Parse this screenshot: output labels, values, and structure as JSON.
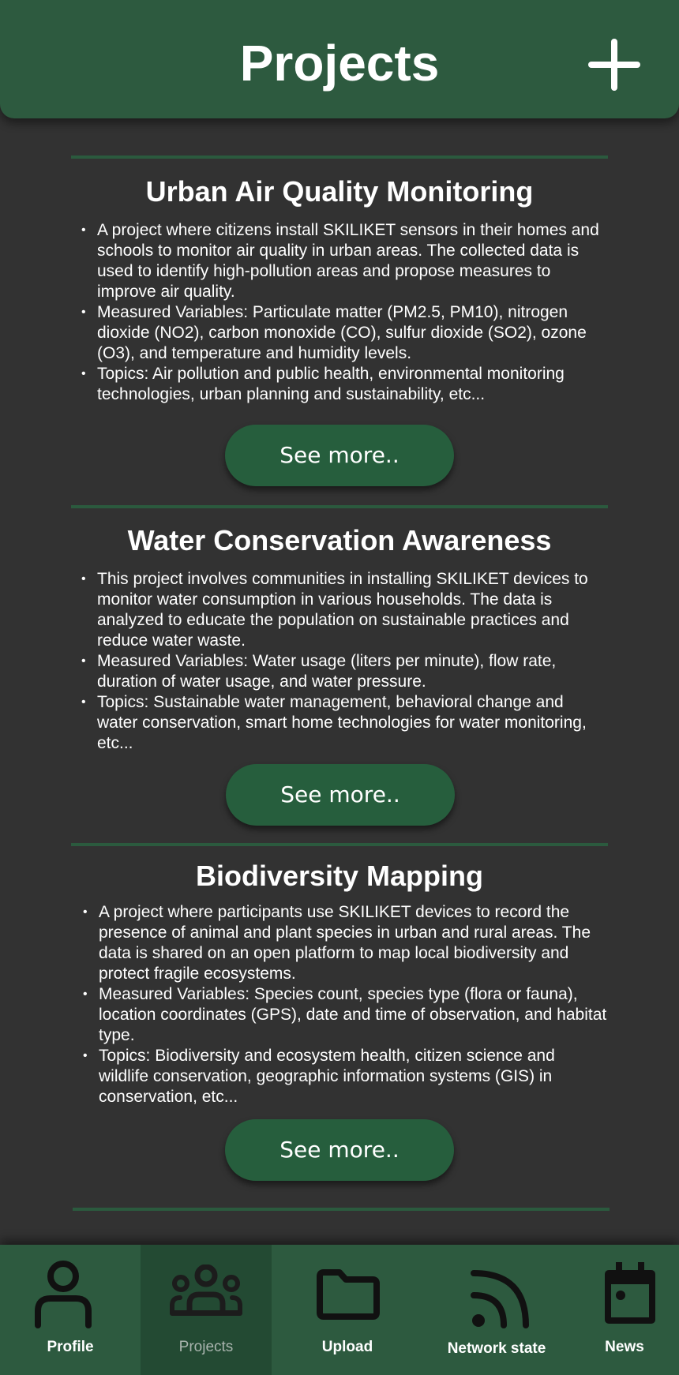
{
  "header": {
    "title": "Projects",
    "add_icon": "plus-icon"
  },
  "projects": [
    {
      "title": "Urban Air Quality Monitoring",
      "bullets": [
        "A project where citizens install SKILIKET sensors in their homes and schools to monitor air quality in urban areas. The collected data is used to identify high-pollution areas and propose measures to improve air quality.",
        "Measured Variables: Particulate matter (PM2.5, PM10), nitrogen dioxide (NO2), carbon monoxide (CO), sulfur dioxide (SO2), ozone (O3), and temperature and humidity levels.",
        "Topics: Air pollution and public health, environmental monitoring technologies, urban planning and sustainability, etc..."
      ],
      "button": "See more.."
    },
    {
      "title": "Water Conservation Awareness",
      "bullets": [
        "This project involves communities in installing SKILIKET devices to monitor water consumption in various households. The data is analyzed to educate the population on sustainable practices and reduce water waste.",
        "Measured Variables: Water usage (liters per minute), flow rate, duration of water usage, and water pressure.",
        "Topics: Sustainable water management, behavioral change and water conservation, smart home technologies for water monitoring, etc..."
      ],
      "button": "See more.."
    },
    {
      "title": "Biodiversity Mapping",
      "bullets": [
        "A project where participants use SKILIKET devices to record the presence of animal and plant species in urban and rural areas. The data is shared on an open platform to map local biodiversity and protect fragile ecosystems.",
        "Measured Variables: Species count, species type (flora or fauna), location coordinates (GPS), date and time of observation, and habitat type.",
        "Topics: Biodiversity and ecosystem health, citizen science and wildlife conservation, geographic information systems (GIS) in conservation, etc..."
      ],
      "button": "See more.."
    }
  ],
  "nav": [
    {
      "label": "Profile",
      "icon": "person-icon",
      "active": false
    },
    {
      "label": "Projects",
      "icon": "group-icon",
      "active": true
    },
    {
      "label": "Upload",
      "icon": "folder-icon",
      "active": false
    },
    {
      "label": "Network state",
      "icon": "rss-icon",
      "active": false
    },
    {
      "label": "News",
      "icon": "calendar-icon",
      "active": false
    }
  ],
  "colors": {
    "background": "#323232",
    "primary_green": "#2d5a3f",
    "button_green": "#265e3d",
    "active_tab": "#234a33"
  }
}
